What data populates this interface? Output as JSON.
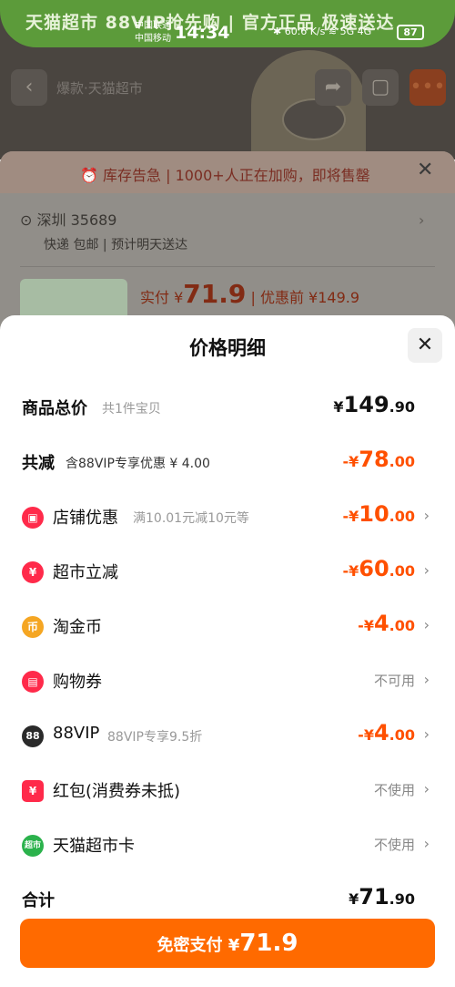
{
  "status_bar": {
    "carrier1": "中国联通",
    "carrier2": "中国移动",
    "time": "14:34",
    "network_speed": "60.6 K/s",
    "signal": "5G  4G",
    "battery": "87"
  },
  "background": {
    "banner_text": "天猫超市 88VIP抢先购 | 官方正品 极速送达",
    "nav_title": "爆款·天猫超市",
    "stock_warning": "⏰ 库存告急 | 1000+人正在加购，即将售罄",
    "address": "深圳 35689",
    "delivery": "快递 包邮 | 预计明天送达",
    "price_label": "实付 ¥",
    "price_value": "71.9",
    "price_before": "| 优惠前 ¥149.9"
  },
  "sheet": {
    "title": "价格明细",
    "rows": [
      {
        "label": "商品总价",
        "sub": "共1件宝贝",
        "prefix": "¥",
        "int": "149",
        "dec": ".90"
      },
      {
        "label": "共减",
        "sub": "含88VIP专享优惠 ¥ 4.00",
        "prefix": "-¥",
        "int": "78",
        "dec": ".00"
      },
      {
        "label": "店铺优惠",
        "sub": "满10.01元减10元等",
        "prefix": "-¥",
        "int": "10",
        "dec": ".00",
        "icon": "store-icon",
        "icon_color": "#ff2a4a"
      },
      {
        "label": "超市立减",
        "sub": "",
        "prefix": "-¥",
        "int": "60",
        "dec": ".00",
        "icon": "yen-icon",
        "icon_color": "#ff2a4a"
      },
      {
        "label": "淘金币",
        "sub": "",
        "prefix": "-¥",
        "int": "4",
        "dec": ".00",
        "icon": "coin-icon",
        "icon_color": "#f5a623"
      },
      {
        "label": "购物券",
        "sub": "",
        "status": "不可用",
        "icon": "coupon-icon",
        "icon_color": "#ff2a4a"
      },
      {
        "label": "88VIP",
        "sub": "88VIP专享9.5折",
        "prefix": "-¥",
        "int": "4",
        "dec": ".00",
        "icon": "vip-88-icon",
        "icon_color": "#2a2a2a",
        "icon_text": "88"
      },
      {
        "label": "红包(消费券未抵)",
        "sub": "",
        "status": "不使用",
        "icon": "red-packet-icon",
        "icon_color": "#ff2a4a"
      },
      {
        "label": "天猫超市卡",
        "sub": "",
        "status": "不使用",
        "icon": "supermarket-card-icon",
        "icon_color": "#2bb24c",
        "icon_text": "超市"
      },
      {
        "label": "合计",
        "sub": "",
        "prefix": "¥",
        "int": "71",
        "dec": ".90"
      }
    ],
    "pay_button": {
      "label": "免密支付 ¥",
      "value": "71.9"
    }
  },
  "colors": {
    "accent_orange": "#ff5000",
    "pay_button": "#ff6a00",
    "icon_red": "#ff2a4a",
    "icon_gold": "#f5a623",
    "icon_green": "#2bb24c"
  }
}
